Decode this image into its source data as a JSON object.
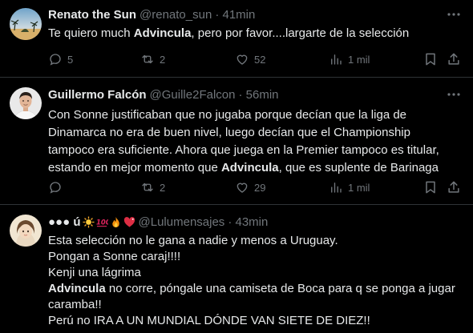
{
  "tweets": [
    {
      "name": "Renato the Sun",
      "handle": "@renato_sun",
      "time": "· 41min",
      "text_lines": [
        {
          "pre": "Te quiero much ",
          "bold": "Advincula",
          "post": ", pero por favor....largarte de la selección"
        }
      ],
      "replies": "5",
      "reposts": "2",
      "likes": "52",
      "views": "1 mil"
    },
    {
      "name": "Guillermo Falcón",
      "handle": "@Guille2Falcon",
      "time": "· 56min",
      "text_lines": [
        {
          "pre": "Con Sonne justificaban que no jugaba porque decían que la liga de",
          "bold": "",
          "post": ""
        },
        {
          "pre": "Dinamarca no era de buen nivel, luego decían que el Championship",
          "bold": "",
          "post": ""
        },
        {
          "pre": "tampoco era suficiente. Ahora que juega en la Premier tampoco es titular,",
          "bold": "",
          "post": ""
        },
        {
          "pre": "estando en mejor momento que ",
          "bold": "Advincula",
          "post": ", que es suplente de Barinaga"
        }
      ],
      "replies": "",
      "reposts": "2",
      "likes": "29",
      "views": "1 mil"
    },
    {
      "name": "●●● ú",
      "handle": "@Lulumensajes",
      "time": "· 43min",
      "name_emojis": [
        "sun-emoji",
        "hundred-emoji",
        "fire-emoji",
        "heart-emoji"
      ],
      "text_lines": [
        {
          "pre": "Esta selección no le gana a nadie y menos a Uruguay.",
          "bold": "",
          "post": ""
        },
        {
          "pre": "Pongan a Sonne caraj!!!!",
          "bold": "",
          "post": ""
        },
        {
          "pre": "Kenji una lágrima",
          "bold": "",
          "post": ""
        },
        {
          "pre": "",
          "bold": "Advincula",
          "post": " no corre, póngale una camiseta de Boca para q se ponga a jugar"
        },
        {
          "pre": "caramba!!",
          "bold": "",
          "post": ""
        },
        {
          "pre": "Perú no IRA A UN MUNDIAL DÓNDE VAN SIETE DE DIEZ!!",
          "bold": "",
          "post": ""
        }
      ]
    }
  ],
  "colors": {
    "background": "#000000",
    "text": "#e7e9ea",
    "muted": "#71767b",
    "divider": "#2f3336"
  }
}
